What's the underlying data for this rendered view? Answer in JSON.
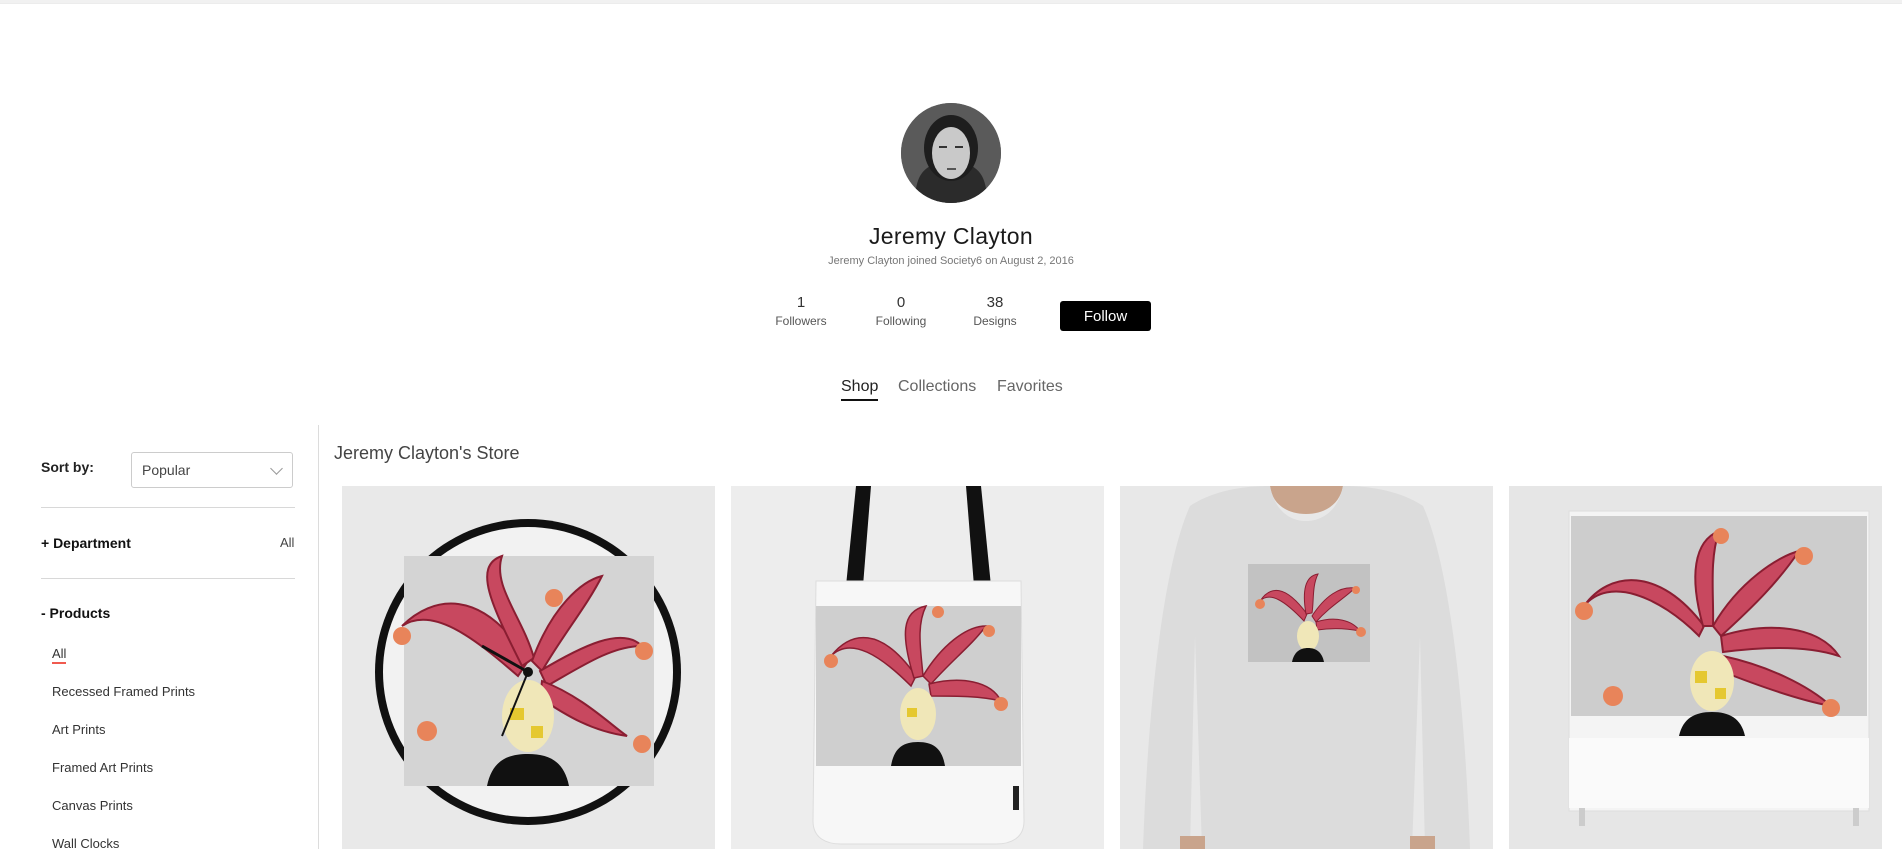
{
  "profile": {
    "name": "Jeremy Clayton",
    "joined": "Jeremy Clayton joined Society6 on August 2, 2016",
    "stats": [
      {
        "value": "1",
        "label": "Followers"
      },
      {
        "value": "0",
        "label": "Following"
      },
      {
        "value": "38",
        "label": "Designs"
      }
    ],
    "follow_label": "Follow"
  },
  "tabs": [
    {
      "label": "Shop",
      "active": true
    },
    {
      "label": "Collections",
      "active": false
    },
    {
      "label": "Favorites",
      "active": false
    }
  ],
  "sidebar": {
    "sort_label": "Sort by:",
    "sort_value": "Popular",
    "department": {
      "label": "+ Department",
      "value": "All"
    },
    "products": {
      "label": "- Products",
      "items": [
        "All",
        "Recessed Framed Prints",
        "Art Prints",
        "Framed Art Prints",
        "Canvas Prints",
        "Wall Clocks"
      ],
      "selected": "All"
    }
  },
  "store": {
    "title": "Jeremy Clayton's Store",
    "products": [
      {
        "kind": "wall-clock"
      },
      {
        "kind": "tote-bag"
      },
      {
        "kind": "long-sleeve-tee"
      },
      {
        "kind": "shower-curtain"
      }
    ]
  },
  "colors": {
    "follow_button": "#000000",
    "selected_underline": "#f05a4f",
    "jester_hat": "#c8485f",
    "bell": "#e8845a"
  }
}
